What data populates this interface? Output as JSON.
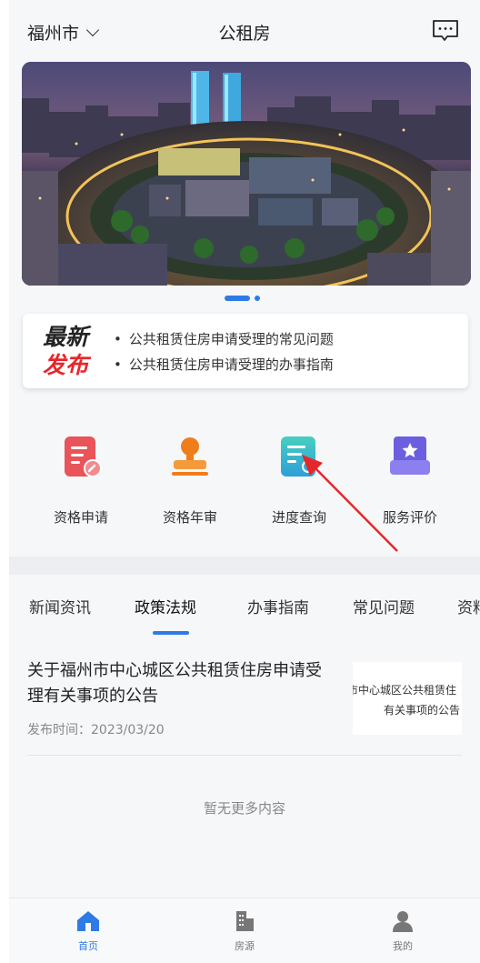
{
  "header": {
    "city": "福州市",
    "title": "公租房",
    "message_icon": "message-icon"
  },
  "banner": {
    "description_icon": "city-night-photo",
    "slides_total": 2,
    "active_slide": 1
  },
  "news_card": {
    "logo_line1": "最新",
    "logo_line2": "发布",
    "items": [
      "公共租赁住房申请受理的常见问题",
      "公共租赁住房申请受理的办事指南"
    ]
  },
  "services": [
    {
      "label": "资格申请",
      "icon": "application-form-icon",
      "color": "#e8545a"
    },
    {
      "label": "资格年审",
      "icon": "stamp-icon",
      "color": "#f07d1c"
    },
    {
      "label": "进度查询",
      "icon": "progress-doc-icon",
      "color": "#36c2b4"
    },
    {
      "label": "服务评价",
      "icon": "rating-star-icon",
      "color": "#6b5fe0"
    }
  ],
  "tabs": [
    {
      "label": "新闻资讯",
      "active": false
    },
    {
      "label": "政策法规",
      "active": true
    },
    {
      "label": "办事指南",
      "active": false
    },
    {
      "label": "常见问题",
      "active": false
    },
    {
      "label": "资料",
      "active": false
    }
  ],
  "article": {
    "title": "关于福州市中心城区公共租赁住房申请受理有关事项的公告",
    "date": "发布时间：2023/03/20",
    "thumb_line1": "市中心城区公共租赁住",
    "thumb_line2": "有关事项的公告"
  },
  "no_more": "暂无更多内容",
  "bottom_nav": [
    {
      "label": "首页",
      "icon": "home-icon",
      "active": true
    },
    {
      "label": "房源",
      "icon": "building-icon",
      "active": false
    },
    {
      "label": "我的",
      "icon": "user-icon",
      "active": false
    }
  ],
  "colors": {
    "accent": "#2e7be6",
    "annotation_arrow": "#e5262b",
    "highlight_red": "#e8262a"
  }
}
